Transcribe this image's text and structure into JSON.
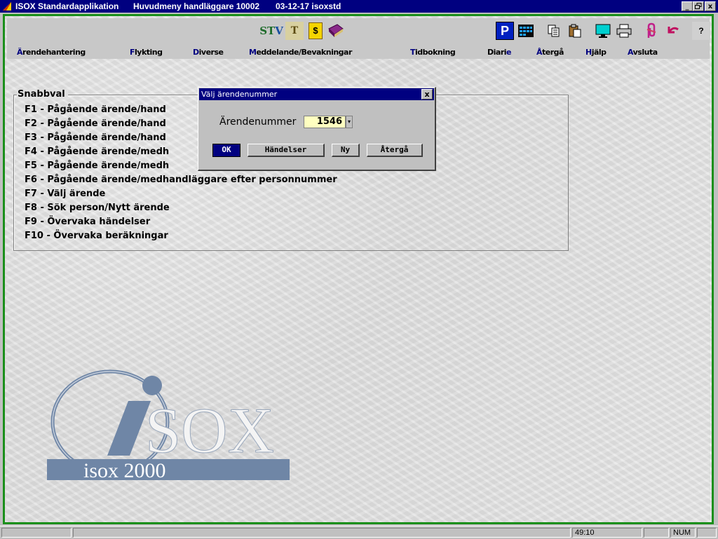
{
  "window": {
    "app_name": "ISOX Standardapplikation",
    "menu_title": "Huvudmeny handläggare 10002",
    "date_user": "03-12-17 isoxstd",
    "minimize": "_",
    "maximize": "▫",
    "close": "x"
  },
  "toolbar": {
    "left_icons": [
      "stv-icon",
      "text-t-icon",
      "dollar-icon",
      "book-icon"
    ],
    "stv": "ST",
    "stv2": "V",
    "t_label": "T",
    "dollar": "$",
    "p_label": "P",
    "help_label": "?"
  },
  "menu": [
    {
      "pre": "",
      "acc": "Ä",
      "rest": "rendehantering"
    },
    {
      "pre": "",
      "acc": "F",
      "rest": "lykting"
    },
    {
      "pre": "",
      "acc": "D",
      "rest": "iverse"
    },
    {
      "pre": "",
      "acc": "M",
      "rest": "eddelande/Bevakningar"
    },
    {
      "pre": "",
      "acc": "T",
      "rest": "idbokning"
    },
    {
      "pre": "Diari",
      "acc": "e",
      "rest": ""
    },
    {
      "pre": "",
      "acc": "Å",
      "rest": "tergå"
    },
    {
      "pre": "",
      "acc": "H",
      "rest": "jälp"
    },
    {
      "pre": "",
      "acc": "A",
      "rest": "vsluta"
    }
  ],
  "snabbval": {
    "legend": "Snabbval",
    "items": [
      "F1 - Pågående ärende/hand",
      "F2 - Pågående ärende/hand",
      "F3 - Pågående ärende/hand",
      "F4 - Pågående ärende/medh",
      "F5 - Pågående ärende/medh",
      "F6 - Pågående ärende/medhandläggare efter personnummer",
      "F7 - Välj ärende",
      "F8 - Sök person/Nytt ärende",
      "F9 - Övervaka händelser",
      "F10 - Övervaka beräkningar"
    ]
  },
  "dialog": {
    "title": "Välj ärendenummer",
    "close": "x",
    "label": "Ärendenummer",
    "value": "1546",
    "dropdown": "▾",
    "buttons": {
      "ok": "OK",
      "handelser": "Händelser",
      "ny": "Ny",
      "atergaa": "Återgå"
    }
  },
  "logo": {
    "mark": "SOX",
    "tagline": "isox 2000"
  },
  "status": {
    "time": "49:10",
    "num": "NUM"
  },
  "colors": {
    "titlebar": "#000080",
    "frame_border": "#1a8f1a",
    "input_bg": "#ffffc0",
    "logo": "#6f86a6"
  }
}
